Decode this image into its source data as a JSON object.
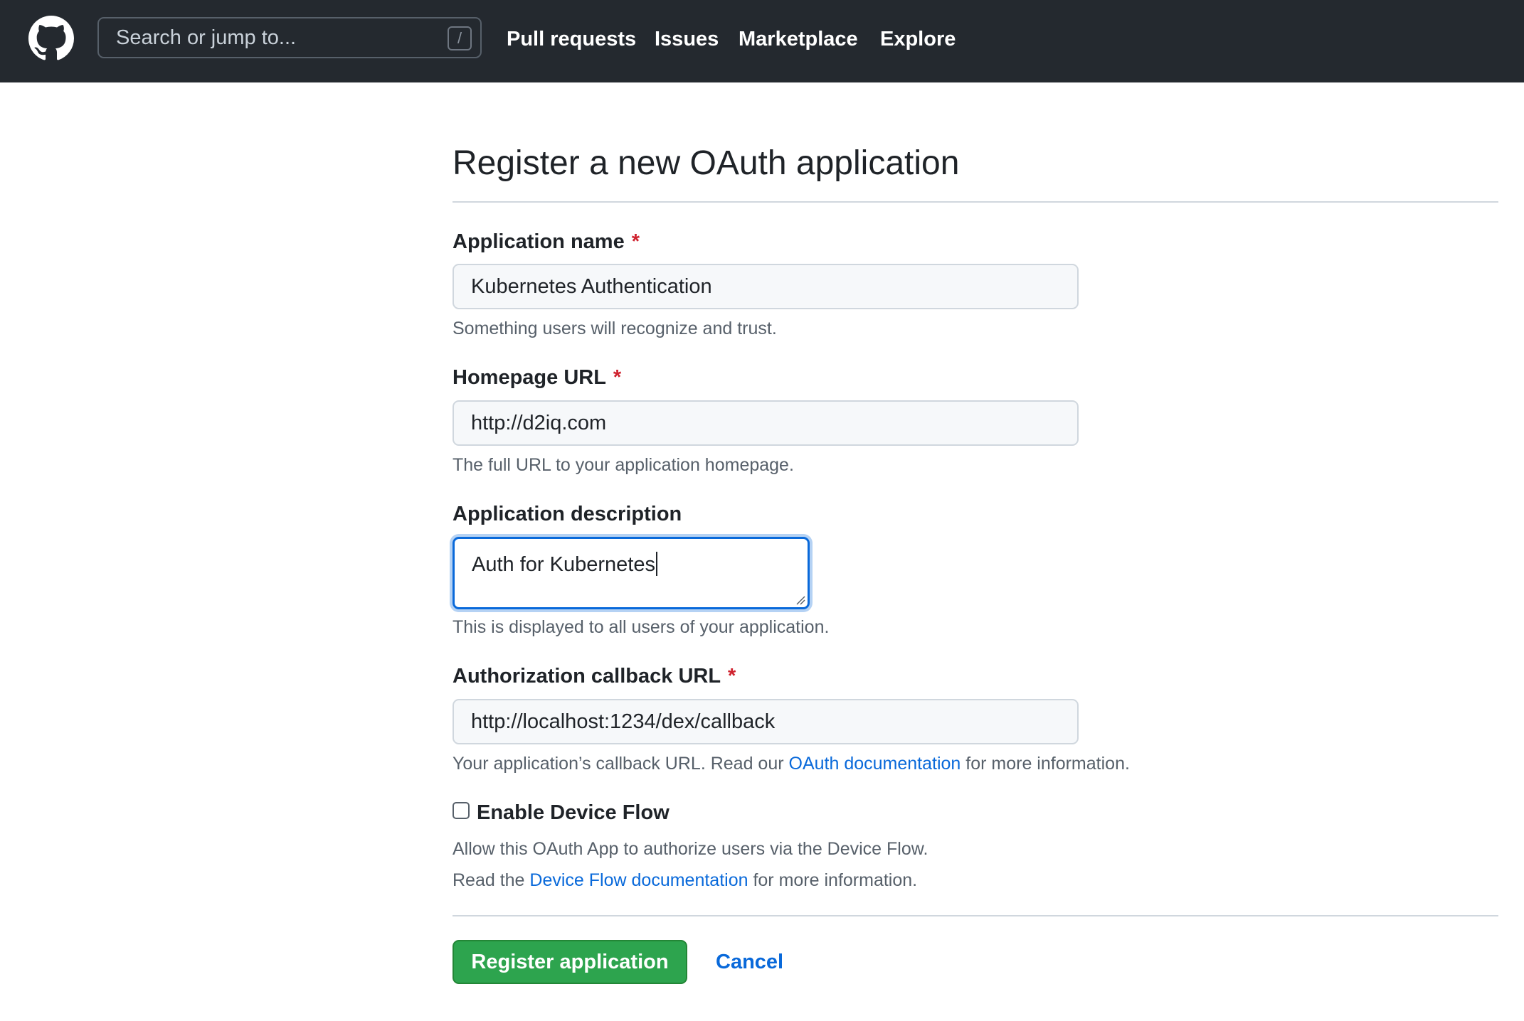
{
  "header": {
    "logo_icon": "github-mark-icon",
    "search": {
      "placeholder": "Search or jump to...",
      "shortcut": "/"
    },
    "nav": [
      "Pull requests",
      "Issues",
      "Marketplace",
      "Explore"
    ]
  },
  "page": {
    "title": "Register a new OAuth application"
  },
  "form": {
    "app_name": {
      "label": "Application name",
      "required_mark": "*",
      "value": "Kubernetes Authentication",
      "note": "Something users will recognize and trust."
    },
    "homepage": {
      "label": "Homepage URL",
      "required_mark": "*",
      "value": "http://d2iq.com",
      "note": "The full URL to your application homepage."
    },
    "description": {
      "label": "Application description",
      "value": "Auth for Kubernetes",
      "note": "This is displayed to all users of your application."
    },
    "callback": {
      "label": "Authorization callback URL",
      "required_mark": "*",
      "value": "http://localhost:1234/dex/callback",
      "note_before": "Your application’s callback URL. Read our ",
      "note_link": "OAuth documentation",
      "note_after": " for more information."
    },
    "device_flow": {
      "label": "Enable Device Flow",
      "checked": false,
      "note1": "Allow this OAuth App to authorize users via the Device Flow.",
      "note2_before": "Read the ",
      "note2_link": "Device Flow documentation",
      "note2_after": " for more information."
    }
  },
  "actions": {
    "register": "Register application",
    "cancel": "Cancel"
  },
  "colors": {
    "header_bg": "#24292f",
    "link": "#0969da",
    "primary_button": "#2da44e",
    "required": "#cf222e",
    "focus_border": "#0969da"
  }
}
